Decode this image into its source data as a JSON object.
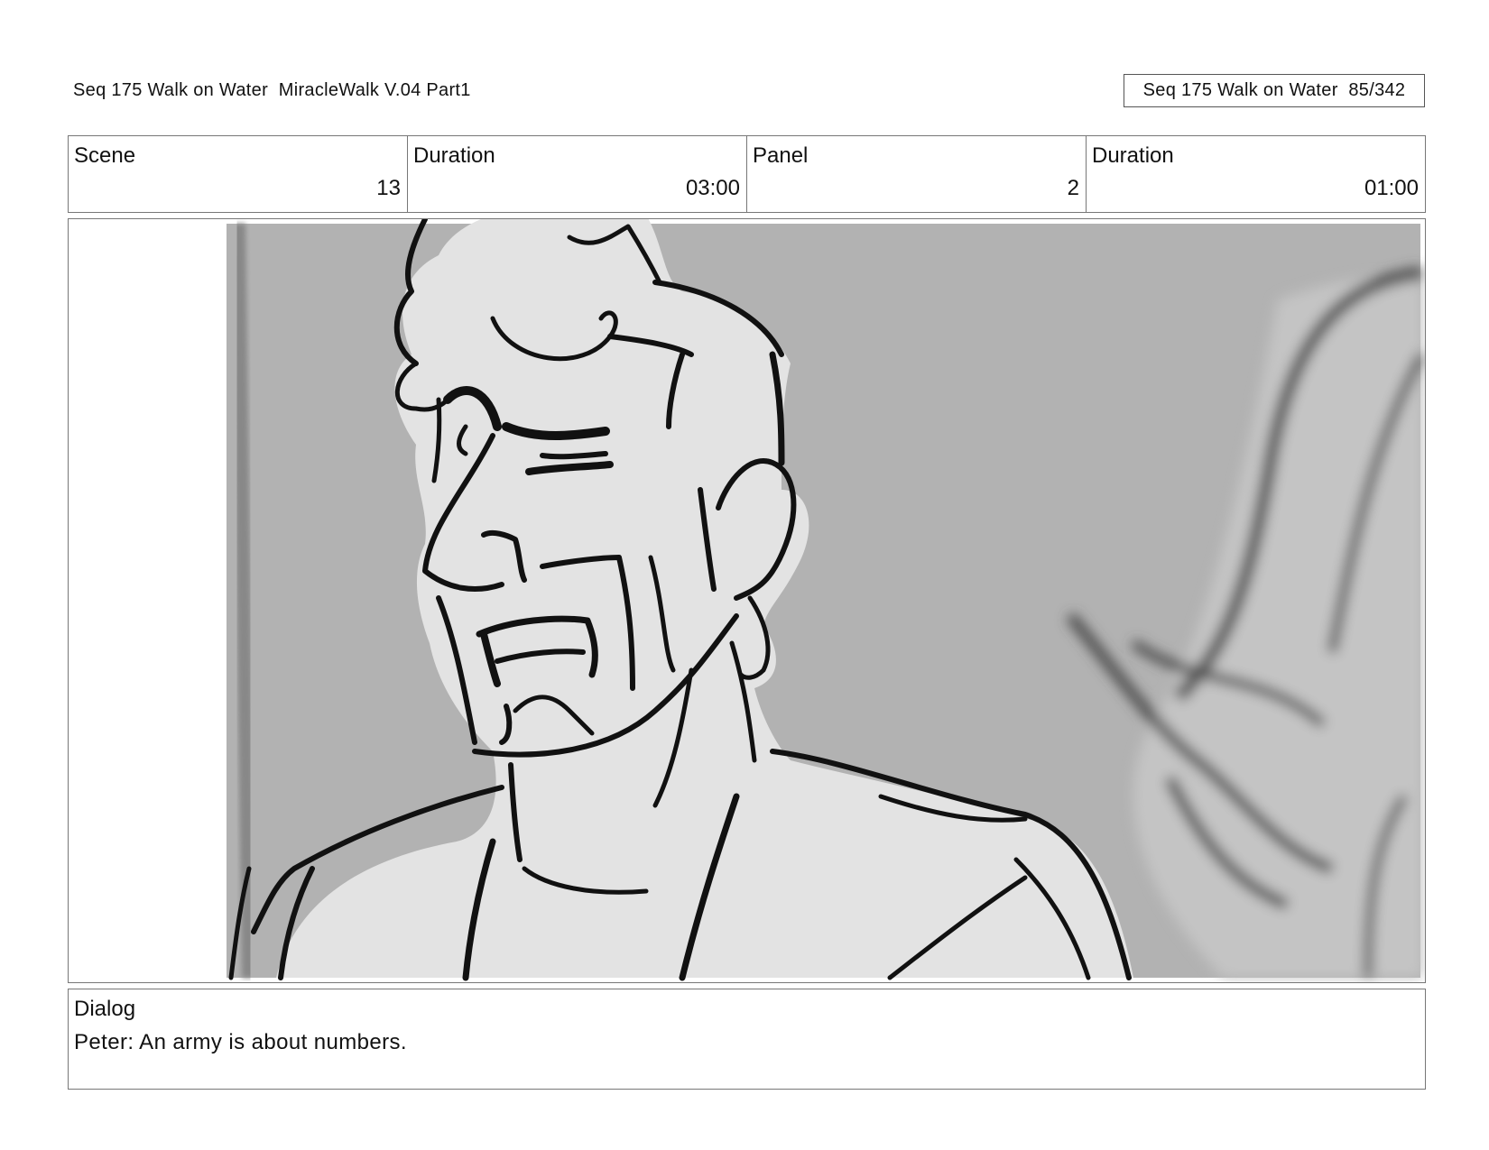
{
  "header": {
    "title": "Seq 175 Walk on Water  MiracleWalk V.04 Part1",
    "page_info": "Seq 175 Walk on Water  85/342"
  },
  "info": {
    "scene_label": "Scene",
    "scene_value": "13",
    "scene_duration_label": "Duration",
    "scene_duration_value": "03:00",
    "panel_label": "Panel",
    "panel_value": "2",
    "panel_duration_label": "Duration",
    "panel_duration_value": "01:00"
  },
  "dialog": {
    "label": "Dialog",
    "text": "Peter: An army is about numbers."
  },
  "colors": {
    "background_gray": "#b2b2b2",
    "figure_fill": "#e3e3e3",
    "line": "#111111",
    "blurred_line": "#4a4a4a"
  }
}
